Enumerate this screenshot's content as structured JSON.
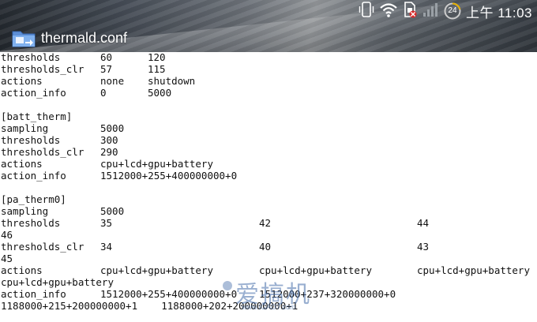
{
  "status_bar": {
    "time": "上午 11:03",
    "battery_level": "24",
    "icons": [
      "phone-vibrate-icon",
      "wifi-icon",
      "sim-blocked-icon",
      "signal-icon",
      "battery-icon"
    ]
  },
  "action_bar": {
    "title": "thermald.conf",
    "icon": "file-manager-icon"
  },
  "file_lines": [
    [
      "thresholds",
      "60",
      "120",
      "",
      ""
    ],
    [
      "thresholds_clr",
      "57",
      "115",
      "",
      ""
    ],
    [
      "actions",
      "none",
      "shutdown",
      "",
      ""
    ],
    [
      "action_info",
      "0",
      "5000",
      "",
      ""
    ],
    [
      "",
      "",
      "",
      "",
      ""
    ],
    [
      "[batt_therm]",
      "",
      "",
      "",
      ""
    ],
    [
      "sampling",
      "5000",
      "",
      "",
      ""
    ],
    [
      "thresholds",
      "300",
      "",
      "",
      ""
    ],
    [
      "thresholds_clr",
      "290",
      "",
      "",
      ""
    ],
    [
      "actions",
      "cpu+lcd+gpu+battery",
      "",
      "",
      ""
    ],
    [
      "action_info",
      "1512000+255+400000000+0",
      "",
      "",
      ""
    ],
    [
      "",
      "",
      "",
      "",
      ""
    ],
    [
      "[pa_therm0]",
      "",
      "",
      "",
      ""
    ],
    [
      "sampling",
      "5000",
      "",
      "",
      ""
    ],
    [
      "thresholds",
      "35",
      "",
      "42",
      "44"
    ],
    [
      "46",
      "",
      "",
      "",
      ""
    ],
    [
      "thresholds_clr",
      "34",
      "",
      "40",
      "43"
    ],
    [
      "45",
      "",
      "",
      "",
      ""
    ],
    [
      "actions",
      "cpu+lcd+gpu+battery",
      "",
      "cpu+lcd+gpu+battery",
      "cpu+lcd+gpu+battery"
    ],
    [
      "cpu+lcd+gpu+battery",
      "",
      "",
      "",
      ""
    ],
    [
      "action_info",
      "1512000+255+400000000+0",
      "",
      "1512000+237+320000000+0",
      ""
    ],
    [
      "1188000+215+200000000+1    1188000+202+200000000+1",
      "",
      "",
      "",
      ""
    ]
  ],
  "watermark": {
    "text": "爱搞机",
    "url": "www.IGAO7.com"
  },
  "colors": {
    "text": "#111111",
    "background": "#ffffff",
    "watermark": "#466eaa"
  }
}
